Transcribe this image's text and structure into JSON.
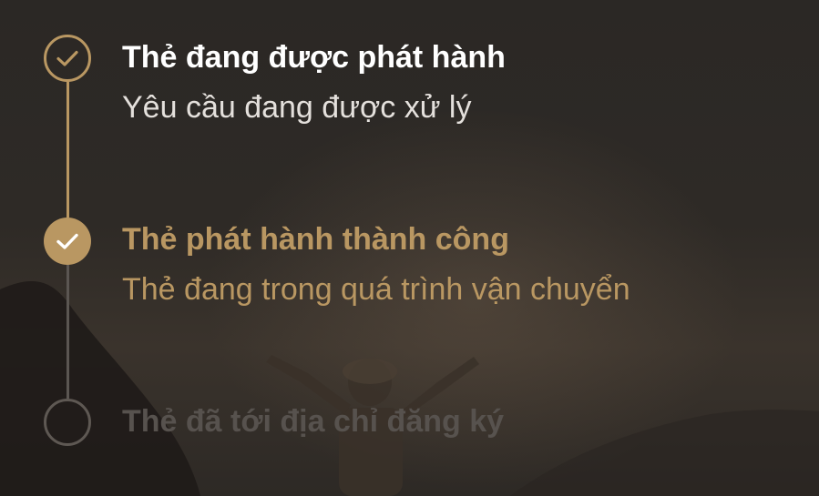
{
  "colors": {
    "accent": "#b99762",
    "text_primary": "#ffffff",
    "text_secondary": "#e4e0dc",
    "pending": "#5b5652",
    "background": "#2c2824"
  },
  "timeline": {
    "steps": [
      {
        "title": "Thẻ đang được phát hành",
        "subtitle": "Yêu cầu đang được xử lý",
        "status": "done",
        "icon": "check-outline-icon"
      },
      {
        "title": "Thẻ phát hành thành công",
        "subtitle": "Thẻ đang trong quá trình vận chuyển",
        "status": "active",
        "icon": "check-filled-icon"
      },
      {
        "title": "Thẻ đã tới địa chỉ đăng ký",
        "status": "pending",
        "icon": "empty-circle-icon"
      }
    ]
  }
}
